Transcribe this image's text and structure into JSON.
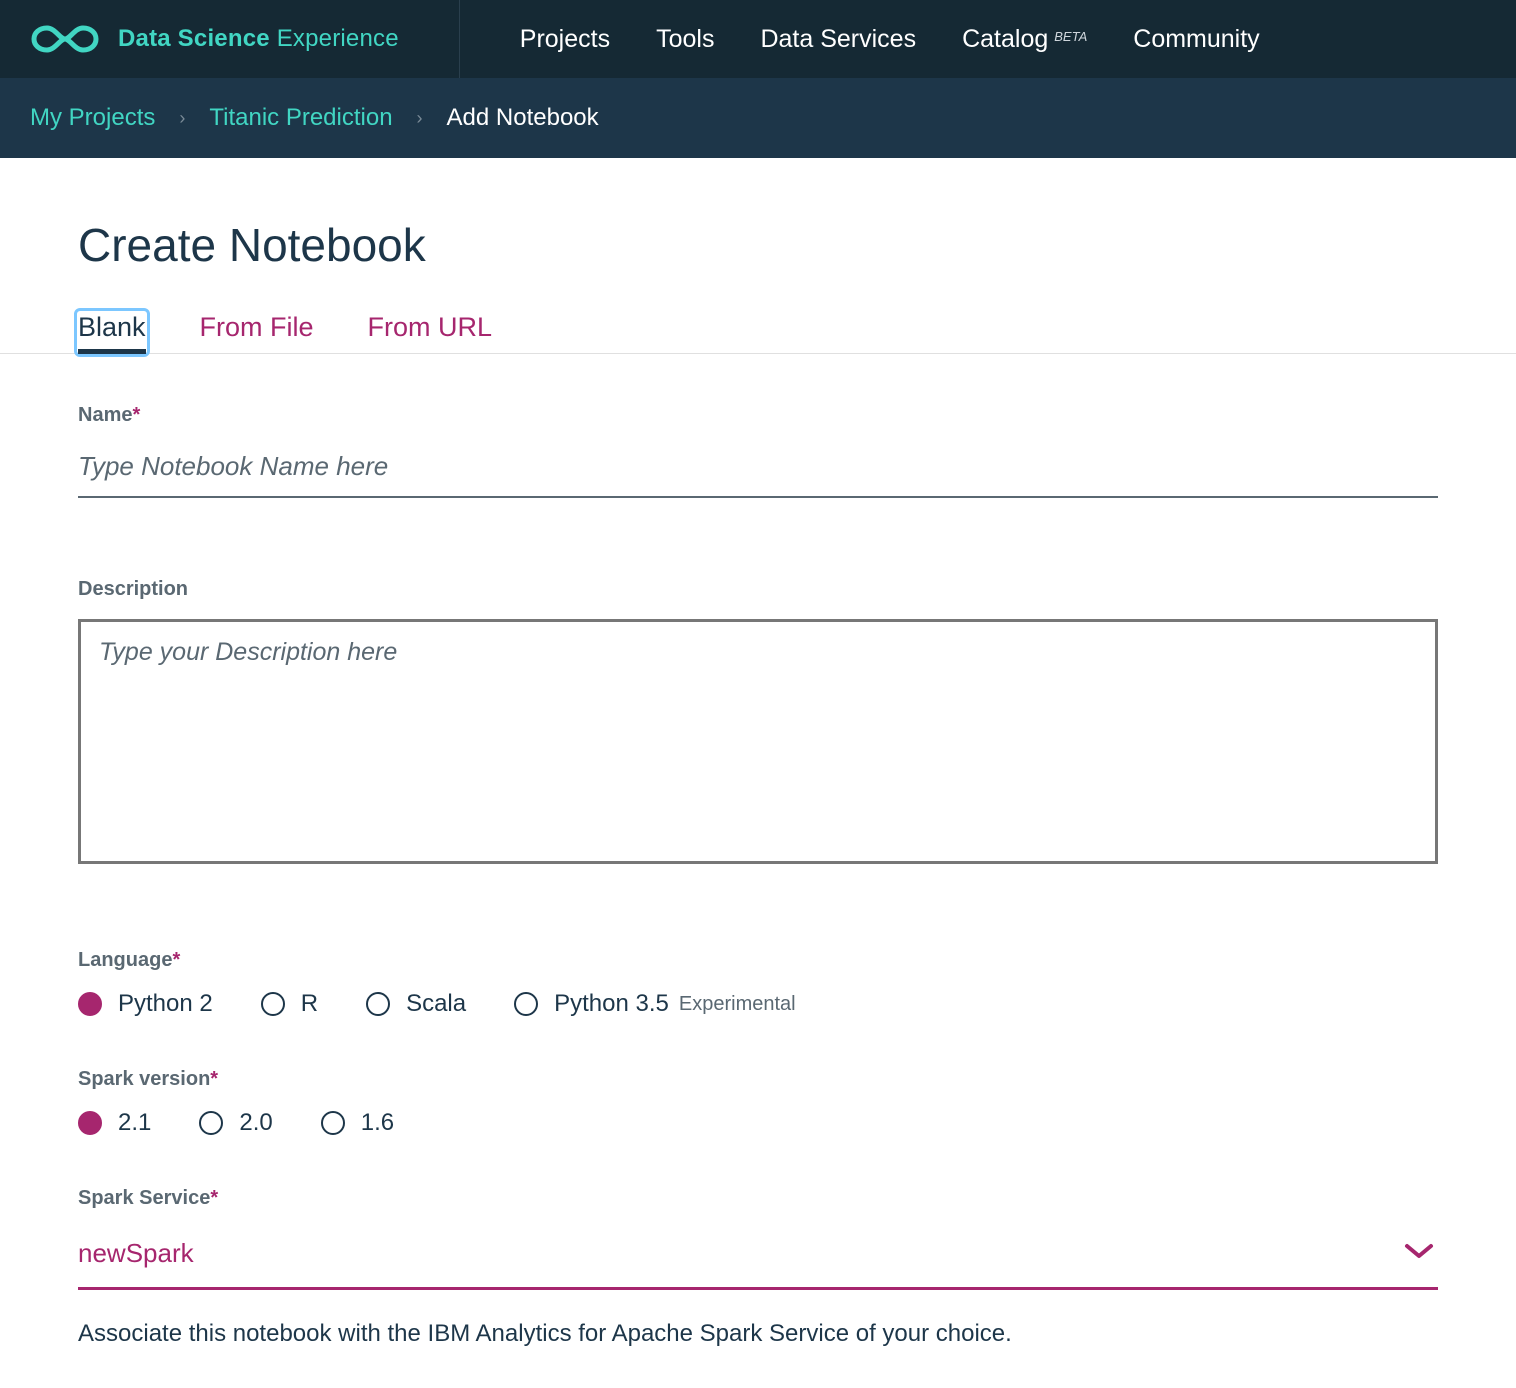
{
  "header": {
    "brand_bold": "Data Science",
    "brand_light": " Experience",
    "nav": [
      {
        "label": "Projects"
      },
      {
        "label": "Tools"
      },
      {
        "label": "Data Services"
      },
      {
        "label": "Catalog",
        "badge": "BETA"
      },
      {
        "label": "Community"
      }
    ]
  },
  "breadcrumb": {
    "items": [
      {
        "label": "My Projects",
        "link": true
      },
      {
        "label": "Titanic Prediction",
        "link": true
      },
      {
        "label": "Add Notebook",
        "link": false
      }
    ]
  },
  "page": {
    "title": "Create Notebook",
    "tabs": [
      {
        "label": "Blank",
        "active": true
      },
      {
        "label": "From File",
        "active": false
      },
      {
        "label": "From URL",
        "active": false
      }
    ]
  },
  "form": {
    "name_label": "Name",
    "name_placeholder": "Type Notebook Name here",
    "name_value": "",
    "desc_label": "Description",
    "desc_placeholder": "Type your Description here",
    "desc_value": "",
    "language_label": "Language",
    "language_options": [
      {
        "label": "Python 2",
        "selected": true
      },
      {
        "label": "R",
        "selected": false
      },
      {
        "label": "Scala",
        "selected": false
      },
      {
        "label": "Python 3.5",
        "selected": false,
        "suffix": "Experimental"
      }
    ],
    "spark_version_label": "Spark version",
    "spark_version_options": [
      {
        "label": "2.1",
        "selected": true
      },
      {
        "label": "2.0",
        "selected": false
      },
      {
        "label": "1.6",
        "selected": false
      }
    ],
    "spark_service_label": "Spark Service",
    "spark_service_value": "newSpark",
    "helper_text": "Associate this notebook with the IBM Analytics for Apache Spark Service of your choice."
  }
}
